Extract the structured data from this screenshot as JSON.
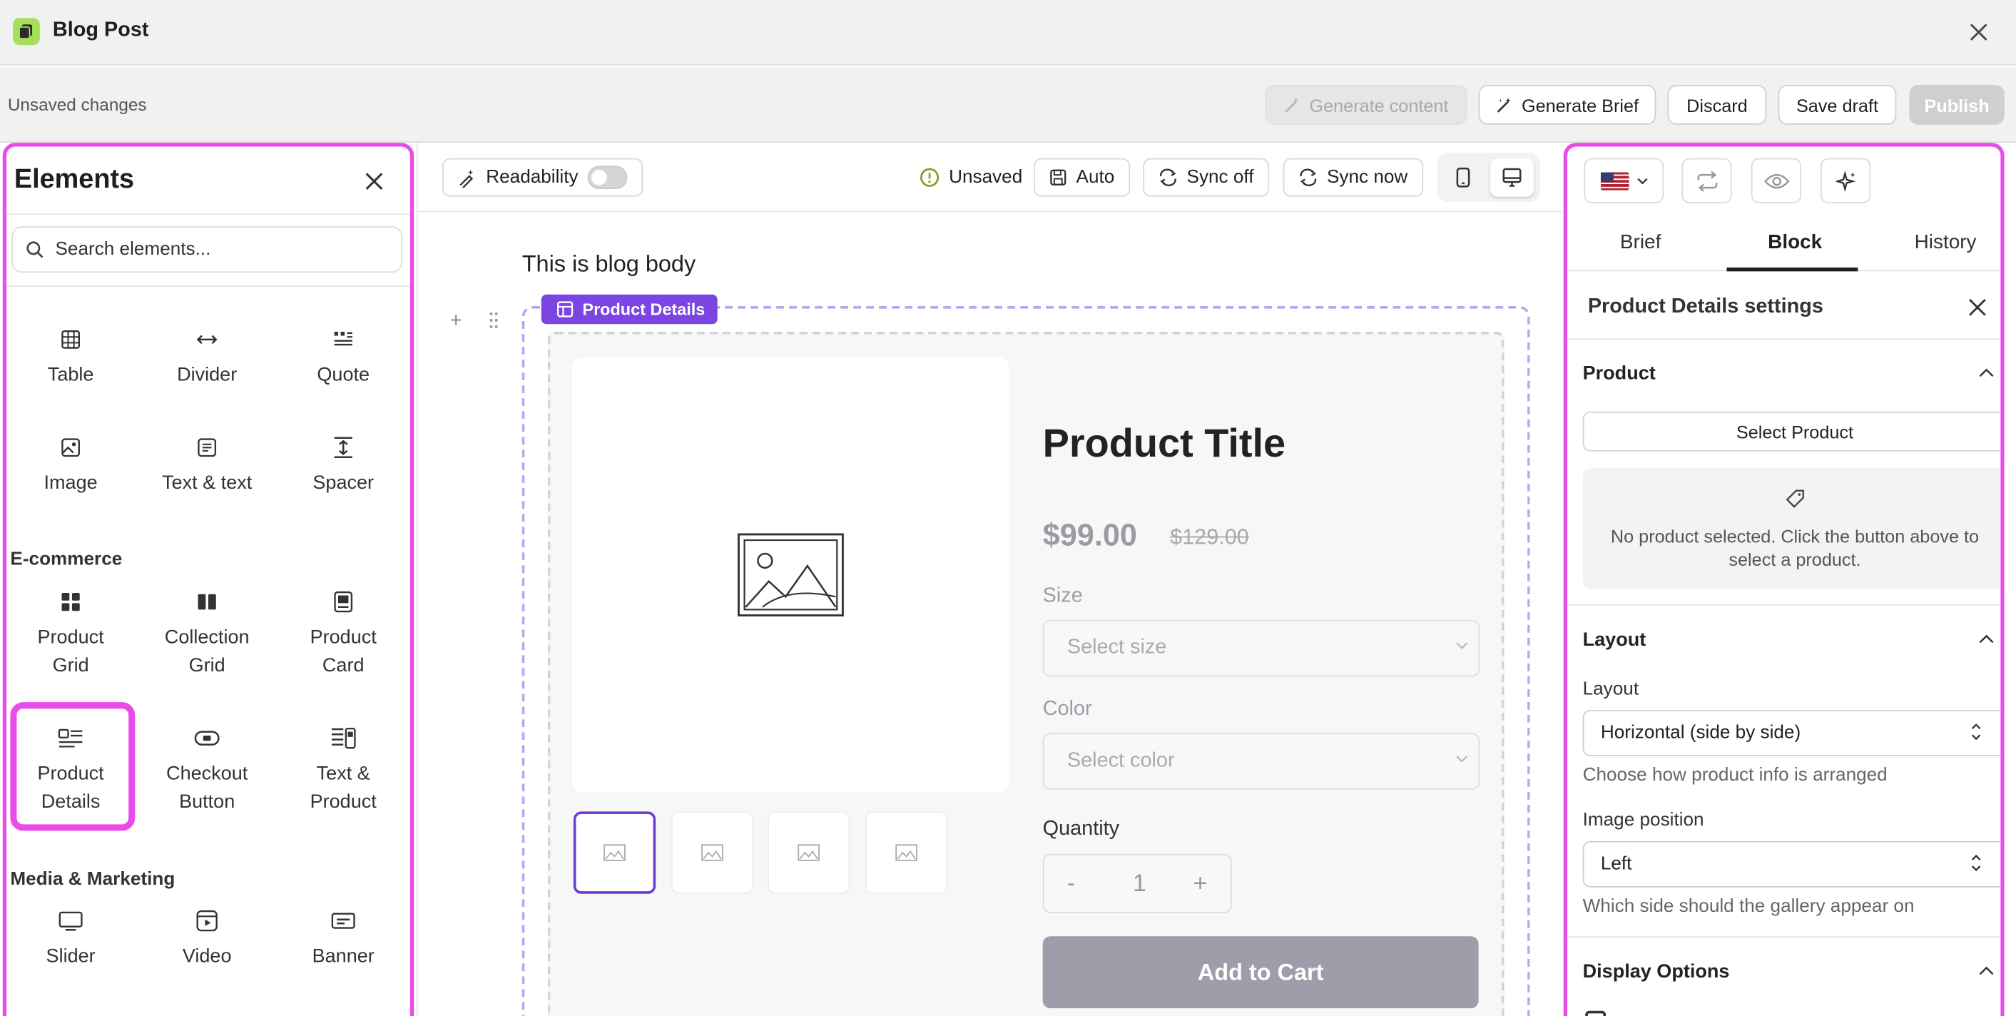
{
  "window": {
    "title": "Blog Post"
  },
  "toolbar": {
    "status": "Unsaved changes",
    "generate_content": "Generate content",
    "generate_brief": "Generate Brief",
    "discard": "Discard",
    "save_draft": "Save draft",
    "publish": "Publish"
  },
  "elements_panel": {
    "title": "Elements",
    "search_placeholder": "Search elements...",
    "basic_items": [
      {
        "label": "Table",
        "icon": "table-icon"
      },
      {
        "label": "Divider",
        "icon": "divider-icon"
      },
      {
        "label": "Quote",
        "icon": "quote-icon"
      },
      {
        "label": "Image",
        "icon": "image-icon"
      },
      {
        "label": "Text & text",
        "icon": "text-icon"
      },
      {
        "label": "Spacer",
        "icon": "spacer-icon"
      }
    ],
    "ecommerce": {
      "label": "E-commerce",
      "items": [
        {
          "label1": "Product",
          "label2": "Grid",
          "icon": "grid-icon"
        },
        {
          "label1": "Collection",
          "label2": "Grid",
          "icon": "columns-icon"
        },
        {
          "label1": "Product",
          "label2": "Card",
          "icon": "card-icon"
        },
        {
          "label1": "Product",
          "label2": "Details",
          "icon": "details-icon"
        },
        {
          "label1": "Checkout",
          "label2": "Button",
          "icon": "checkout-icon"
        },
        {
          "label1": "Text &",
          "label2": "Product",
          "icon": "text-product-icon"
        }
      ]
    },
    "media": {
      "label": "Media & Marketing",
      "items": [
        {
          "label": "Slider",
          "icon": "slider-icon"
        },
        {
          "label": "Video",
          "icon": "video-icon"
        },
        {
          "label": "Banner",
          "icon": "banner-icon"
        }
      ]
    }
  },
  "editor": {
    "readability": "Readability",
    "unsaved": "Unsaved",
    "auto": "Auto",
    "sync_off": "Sync off",
    "sync_now": "Sync now",
    "body_text": "This is blog body",
    "block_tag": "Product Details",
    "product": {
      "title": "Product Title",
      "price": "$99.00",
      "compare_price": "$129.00",
      "size_label": "Size",
      "size_placeholder": "Select size",
      "color_label": "Color",
      "color_placeholder": "Select color",
      "quantity_label": "Quantity",
      "qty_minus": "-",
      "qty_value": "1",
      "qty_plus": "+",
      "add_to_cart": "Add to Cart"
    }
  },
  "settings_panel": {
    "tabs": [
      "Brief",
      "Block",
      "History"
    ],
    "active_tab": "Block",
    "title": "Product Details settings",
    "product_section": "Product",
    "select_product": "Select Product",
    "empty_line1": "No product selected. Click the button above to",
    "empty_line2": "select a product.",
    "layout_section": "Layout",
    "layout_label": "Layout",
    "layout_value": "Horizontal (side by side)",
    "layout_help": "Choose how product info is arranged",
    "image_position_label": "Image position",
    "image_position_value": "Left",
    "image_position_help": "Which side should the gallery appear on",
    "display_section": "Display Options"
  },
  "colors": {
    "highlight": "#e94ce9",
    "accent_purple": "#7a45e0",
    "app_icon": "#a6e05a",
    "add_to_cart_bg": "#9d9ea9"
  }
}
